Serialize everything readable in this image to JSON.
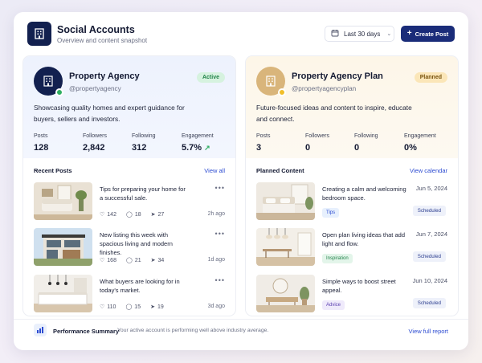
{
  "header": {
    "title": "Social Accounts",
    "subtitle": "Overview and content snapshot",
    "date_range": "Last 30 days",
    "create_label": "Create Post"
  },
  "accounts": [
    {
      "name": "Property Agency",
      "handle": "@propertyagency",
      "status": "Active",
      "description": "Showcasing quality homes and expert guidance for buyers, sellers and investors.",
      "stats": [
        {
          "label": "Posts",
          "value": "128"
        },
        {
          "label": "Followers",
          "value": "2,842"
        },
        {
          "label": "Following",
          "value": "312"
        },
        {
          "label": "Engagement",
          "value": "5.7%"
        }
      ]
    },
    {
      "name": "Property Agency Plan",
      "handle": "@propertyagencyplan",
      "status": "Planned",
      "description": "Future-focused ideas and content to inspire, educate and connect.",
      "stats": [
        {
          "label": "Posts",
          "value": "3"
        },
        {
          "label": "Followers",
          "value": "0"
        },
        {
          "label": "Following",
          "value": "0"
        },
        {
          "label": "Engagement",
          "value": "0%"
        }
      ]
    }
  ],
  "recent_posts": {
    "title": "Recent Posts",
    "link": "View all",
    "items": [
      {
        "text": "Tips for preparing your home for a successful sale.",
        "likes": "142",
        "comments": "18",
        "shares": "27",
        "ago": "2h ago"
      },
      {
        "text": "New listing this week with spacious living and modern finishes.",
        "likes": "168",
        "comments": "21",
        "shares": "34",
        "ago": "1d ago"
      },
      {
        "text": "What buyers are looking for in today's market.",
        "likes": "110",
        "comments": "15",
        "shares": "19",
        "ago": "3d ago"
      }
    ]
  },
  "planned_content": {
    "title": "Planned Content",
    "link": "View calendar",
    "items": [
      {
        "text": "Creating a calm and welcoming bedroom space.",
        "date": "Jun 5, 2024",
        "tag": "Tips",
        "status": "Scheduled"
      },
      {
        "text": "Open plan living ideas that add light and flow.",
        "date": "Jun 7, 2024",
        "tag": "Inspiration",
        "status": "Scheduled"
      },
      {
        "text": "Simple ways to boost street appeal.",
        "date": "Jun 10, 2024",
        "tag": "Advice",
        "status": "Scheduled"
      }
    ]
  },
  "footer": {
    "title": "Performance Summary",
    "text": "Your active account is performing well above industry average.",
    "link": "View full report"
  },
  "colors": {
    "accent": "#1a2c79",
    "active": "#2fae62",
    "planned": "#f1be2a",
    "link": "#2c4bd1"
  }
}
